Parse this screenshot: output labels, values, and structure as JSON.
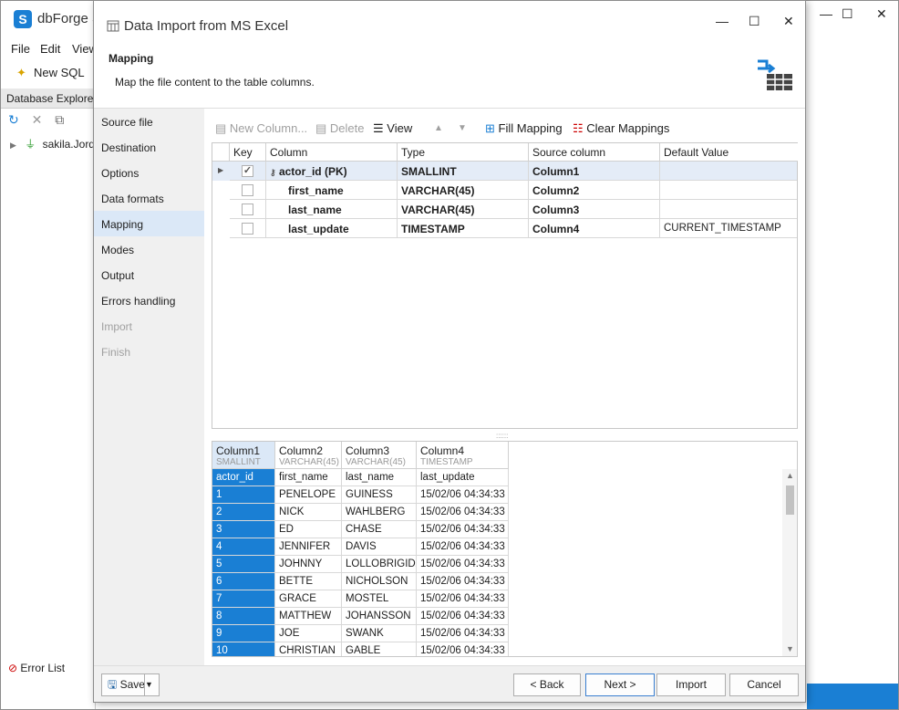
{
  "app": {
    "title": "dbForge S",
    "logo": "S",
    "menu": [
      "File",
      "Edit",
      "View"
    ],
    "toolbar_new_sql": "New SQL",
    "db_explorer_title": "Database Explorer -",
    "tree_item": "sakila.Jorda",
    "error_list": "Error List"
  },
  "dialog": {
    "title": "Data Import from MS Excel",
    "header_title": "Mapping",
    "header_subtitle": "Map the file content to the table columns.",
    "steps": [
      {
        "label": "Source file",
        "state": "normal"
      },
      {
        "label": "Destination",
        "state": "normal"
      },
      {
        "label": "Options",
        "state": "normal"
      },
      {
        "label": "Data formats",
        "state": "normal"
      },
      {
        "label": "Mapping",
        "state": "active"
      },
      {
        "label": "Modes",
        "state": "normal"
      },
      {
        "label": "Output",
        "state": "normal"
      },
      {
        "label": "Errors handling",
        "state": "normal"
      },
      {
        "label": "Import",
        "state": "disabled"
      },
      {
        "label": "Finish",
        "state": "disabled"
      }
    ],
    "toolbar": {
      "new_column": "New Column...",
      "delete": "Delete",
      "view": "View",
      "fill_mapping": "Fill Mapping",
      "clear_mappings": "Clear Mappings"
    },
    "mapping_headers": [
      "Key",
      "Column",
      "Type",
      "Source column",
      "Default Value"
    ],
    "mapping_rows": [
      {
        "key": true,
        "column": "actor_id (PK)",
        "type": "SMALLINT",
        "source": "Column1",
        "default": ""
      },
      {
        "key": false,
        "column": "first_name",
        "type": "VARCHAR(45)",
        "source": "Column2",
        "default": ""
      },
      {
        "key": false,
        "column": "last_name",
        "type": "VARCHAR(45)",
        "source": "Column3",
        "default": ""
      },
      {
        "key": false,
        "column": "last_update",
        "type": "TIMESTAMP",
        "source": "Column4",
        "default": "CURRENT_TIMESTAMP"
      }
    ],
    "preview_headers": [
      {
        "name": "Column1",
        "type": "SMALLINT"
      },
      {
        "name": "Column2",
        "type": "VARCHAR(45)"
      },
      {
        "name": "Column3",
        "type": "VARCHAR(45)"
      },
      {
        "name": "Column4",
        "type": "TIMESTAMP"
      }
    ],
    "preview_rows": [
      [
        "actor_id",
        "first_name",
        "last_name",
        "last_update"
      ],
      [
        "1",
        "PENELOPE",
        "GUINESS",
        "15/02/06 04:34:33"
      ],
      [
        "2",
        "NICK",
        "WAHLBERG",
        "15/02/06 04:34:33"
      ],
      [
        "3",
        "ED",
        "CHASE",
        "15/02/06 04:34:33"
      ],
      [
        "4",
        "JENNIFER",
        "DAVIS",
        "15/02/06 04:34:33"
      ],
      [
        "5",
        "JOHNNY",
        "LOLLOBRIGIDA",
        "15/02/06 04:34:33"
      ],
      [
        "6",
        "BETTE",
        "NICHOLSON",
        "15/02/06 04:34:33"
      ],
      [
        "7",
        "GRACE",
        "MOSTEL",
        "15/02/06 04:34:33"
      ],
      [
        "8",
        "MATTHEW",
        "JOHANSSON",
        "15/02/06 04:34:33"
      ],
      [
        "9",
        "JOE",
        "SWANK",
        "15/02/06 04:34:33"
      ],
      [
        "10",
        "CHRISTIAN",
        "GABLE",
        "15/02/06 04:34:33"
      ]
    ],
    "buttons": {
      "save": "Save",
      "back": "< Back",
      "next": "Next >",
      "import": "Import",
      "cancel": "Cancel"
    }
  },
  "colors": {
    "accent": "#1a7fd4",
    "active_step": "#dbe8f7"
  }
}
